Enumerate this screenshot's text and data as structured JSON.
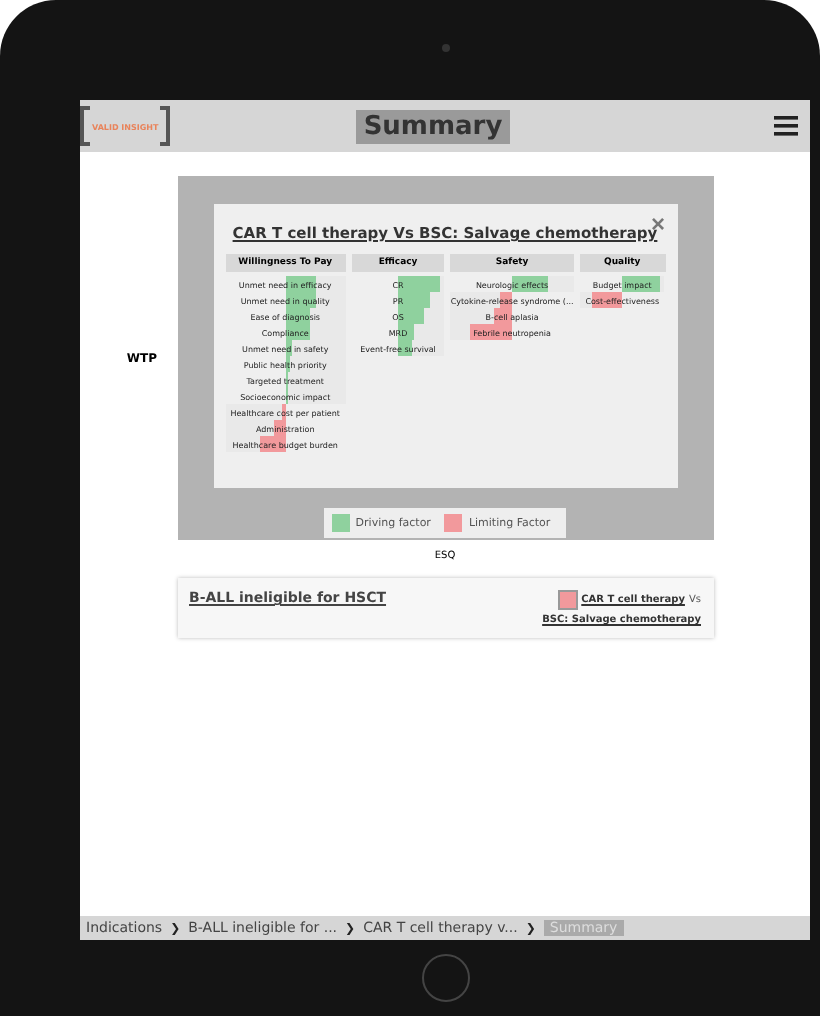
{
  "header": {
    "logo": "VALID INSIGHT",
    "title": "Summary"
  },
  "side_label": "WTP",
  "card": {
    "title": "CAR T cell therapy Vs BSC: Salvage chemotherapy",
    "close": "×",
    "columns": [
      {
        "heading": "Willingness To Pay",
        "items": [
          {
            "label": "Unmet need in efficacy",
            "kind": "driving",
            "level": 0.5
          },
          {
            "label": "Unmet need in quality",
            "kind": "driving",
            "level": 0.5
          },
          {
            "label": "Ease of diagnosis",
            "kind": "driving",
            "level": 0.42
          },
          {
            "label": "Compliance",
            "kind": "driving",
            "level": 0.42
          },
          {
            "label": "Unmet need in safety",
            "kind": "driving",
            "level": 0.1
          },
          {
            "label": "Public health priority",
            "kind": "driving",
            "level": 0.08
          },
          {
            "label": "Targeted treatment",
            "kind": "driving",
            "level": 0.04
          },
          {
            "label": "Socioeconomic impact",
            "kind": "driving",
            "level": 0.02
          },
          {
            "label": "Healthcare cost per patient",
            "kind": "limiting",
            "level": 0.06
          },
          {
            "label": "Administration",
            "kind": "limiting",
            "level": 0.2
          },
          {
            "label": "Healthcare budget burden",
            "kind": "limiting",
            "level": 0.42
          }
        ]
      },
      {
        "heading": "Efficacy",
        "items": [
          {
            "label": "CR",
            "kind": "driving",
            "level": 0.9
          },
          {
            "label": "PR",
            "kind": "driving",
            "level": 0.7
          },
          {
            "label": "OS",
            "kind": "driving",
            "level": 0.55
          },
          {
            "label": "MRD",
            "kind": "driving",
            "level": 0.35
          },
          {
            "label": "Event-free survival",
            "kind": "driving",
            "level": 0.3
          }
        ]
      },
      {
        "heading": "Safety",
        "items": [
          {
            "label": "Neurologic effects",
            "kind": "driving",
            "level": 0.6
          },
          {
            "label": "Cytokine-release syndrome (...",
            "kind": "limiting",
            "level": 0.2
          },
          {
            "label": "B-cell aplasia",
            "kind": "limiting",
            "level": 0.3
          },
          {
            "label": "Febrile neutropenia",
            "kind": "limiting",
            "level": 0.7
          }
        ]
      },
      {
        "heading": "Quality",
        "items": [
          {
            "label": "Budget impact",
            "kind": "driving",
            "level": 0.9
          },
          {
            "label": "Cost-effectiveness",
            "kind": "limiting",
            "level": 0.7
          }
        ]
      }
    ]
  },
  "legend": [
    {
      "label": "Driving factor",
      "kind": "driving"
    },
    {
      "label": "Limiting Factor",
      "kind": "limiting"
    }
  ],
  "axis_label": "ESQ",
  "indication": {
    "title": "B-ALL ineligible for HSCT",
    "kind": "limiting",
    "link_line1": "CAR T cell therapy",
    "link_vs": "Vs",
    "link_line2": "BSC: Salvage chemotherapy"
  },
  "breadcrumb": [
    {
      "label": "Indications",
      "selected": false
    },
    {
      "label": "B-ALL ineligible for ...",
      "selected": false
    },
    {
      "label": "CAR T cell therapy v...",
      "selected": false
    },
    {
      "label": "Summary",
      "selected": true
    }
  ],
  "separator": "❯"
}
